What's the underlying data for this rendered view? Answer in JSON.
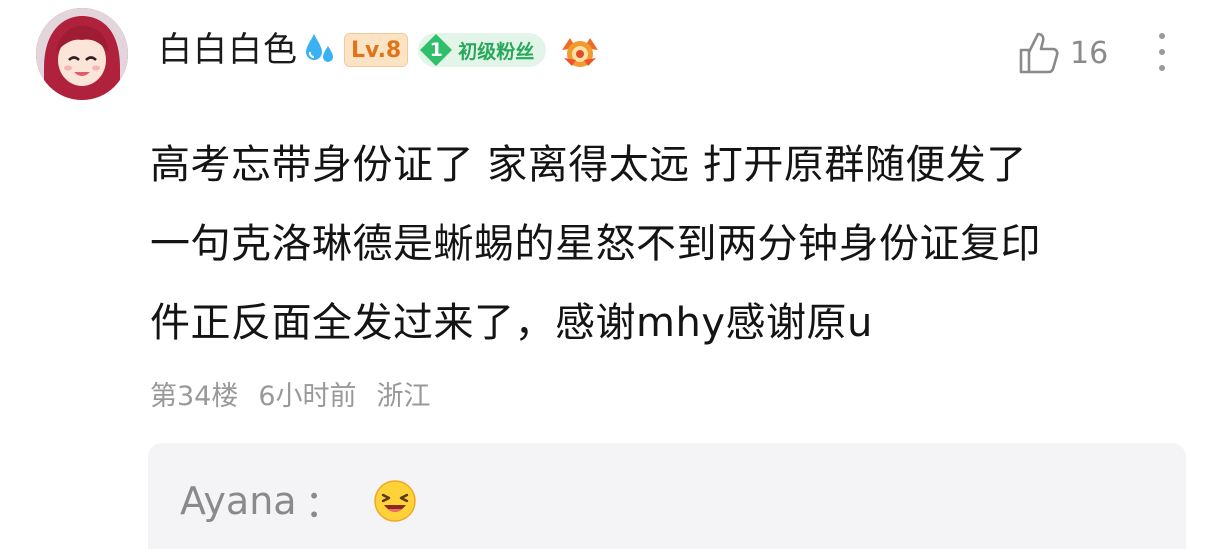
{
  "comment": {
    "user": {
      "name": "白白白色",
      "level_badge": "Lv.8",
      "fan_badge": {
        "level": "1",
        "label": "初级粉丝"
      }
    },
    "likes": "16",
    "text_lines": [
      "高考忘带身份证了 家离得太远 打开原群随便发了",
      "一句克洛琳德是蜥蜴的星怒不到两分钟身份证复印",
      "件正反面全发过来了，感谢mhy感谢原u"
    ],
    "meta": {
      "floor": "第34楼",
      "time": "6小时前",
      "location": "浙江"
    },
    "reply": {
      "user": "Ayana",
      "colon": "："
    }
  },
  "colors": {
    "level_badge": "#e0741a",
    "fan_badge": "#27a85a",
    "meta_text": "#999999",
    "reply_bg": "#f4f4f6"
  },
  "icons": [
    "avatar",
    "water-drop-icon",
    "medal-icon",
    "thumbs-up-icon",
    "more-icon",
    "laughing-emoji-icon"
  ]
}
